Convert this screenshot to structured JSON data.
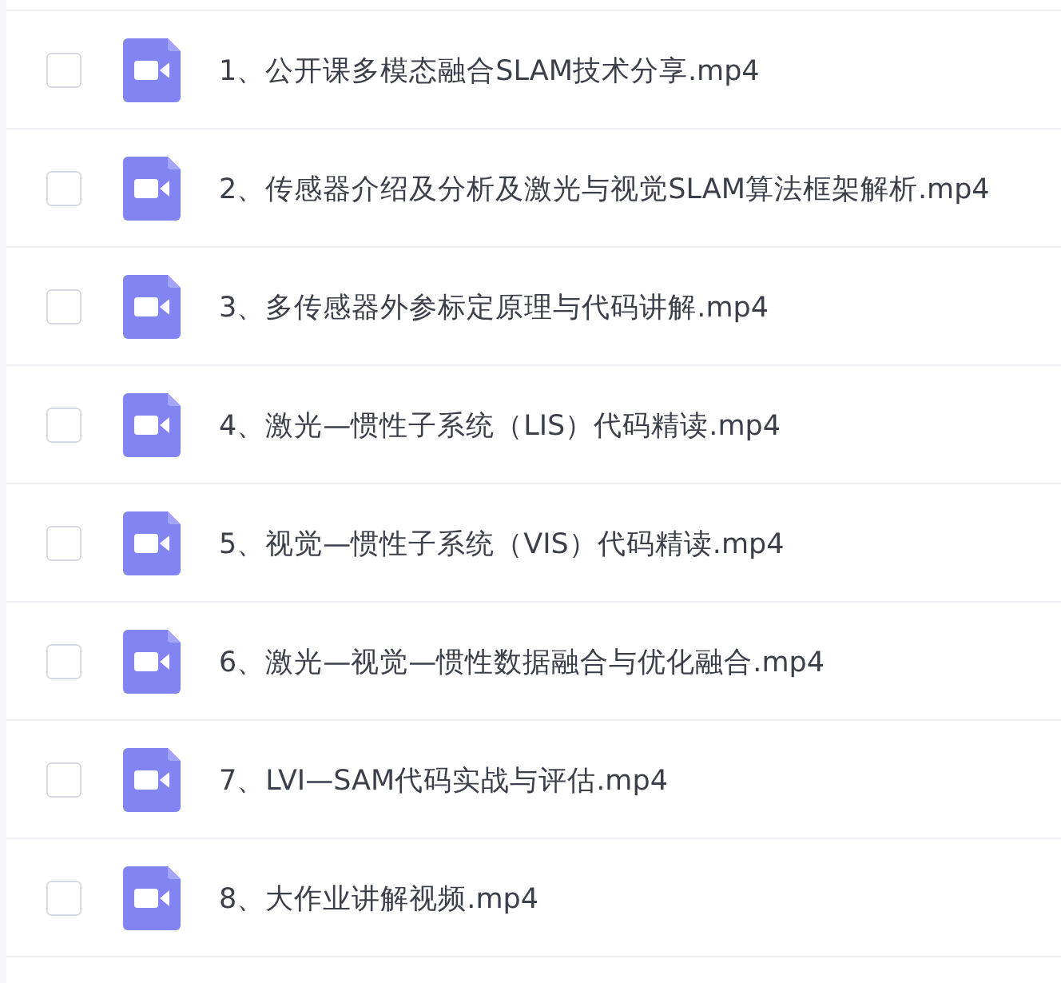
{
  "files": [
    {
      "name": "1、公开课多模态融合SLAM技术分享.mp4",
      "checked": false
    },
    {
      "name": "2、传感器介绍及分析及激光与视觉SLAM算法框架解析.mp4",
      "checked": false
    },
    {
      "name": "3、多传感器外参标定原理与代码讲解.mp4",
      "checked": false
    },
    {
      "name": "4、激光—惯性子系统（LIS）代码精读.mp4",
      "checked": false
    },
    {
      "name": "5、视觉—惯性子系统（VIS）代码精读.mp4",
      "checked": false
    },
    {
      "name": "6、激光—视觉—惯性数据融合与优化融合.mp4",
      "checked": false
    },
    {
      "name": "7、LVI—SAM代码实战与评估.mp4",
      "checked": false
    },
    {
      "name": "8、大作业讲解视频.mp4",
      "checked": false
    }
  ]
}
